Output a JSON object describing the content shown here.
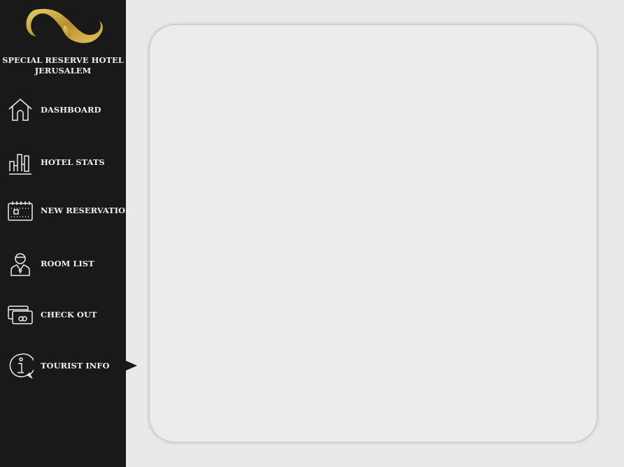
{
  "brand": {
    "line1": "SPECIAL RESERVE HOTEL",
    "line2": "JERUSALEM"
  },
  "nav": [
    {
      "label": "DASHBOARD",
      "icon": "house-icon"
    },
    {
      "label": "HOTEL STATS",
      "icon": "bar-chart-icon"
    },
    {
      "label": "NEW RESERVATION",
      "icon": "calendar-icon"
    },
    {
      "label": "ROOM LIST",
      "icon": "person-icon"
    },
    {
      "label": "CHECK OUT",
      "icon": "credit-card-icon"
    },
    {
      "label": "TOURIST INFO",
      "icon": "info-icon"
    }
  ],
  "colors": {
    "sidebar": "#191919",
    "gold": "#c9a53a",
    "background": "#e8e9e9"
  }
}
